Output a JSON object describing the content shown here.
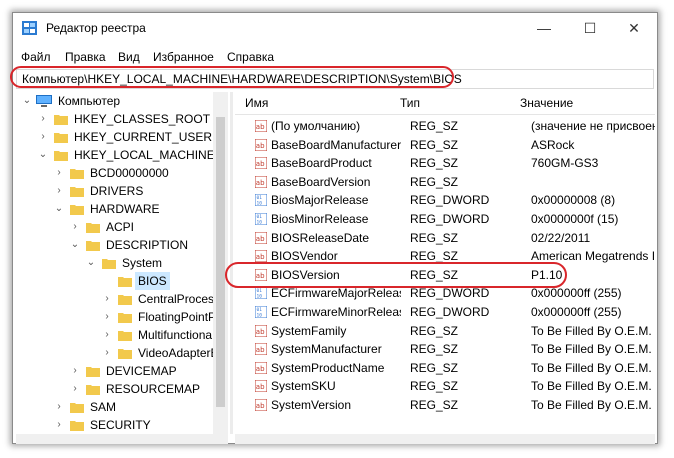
{
  "window": {
    "title": "Редактор реестра",
    "controls": {
      "minimize": "—",
      "maximize": "☐",
      "close": "✕"
    }
  },
  "menu": [
    "Файл",
    "Правка",
    "Вид",
    "Избранное",
    "Справка"
  ],
  "address": {
    "path": "Компьютер\\HKEY_LOCAL_MACHINE\\HARDWARE\\DESCRIPTION\\System\\BIOS"
  },
  "tree": {
    "items": [
      {
        "label": "Компьютер"
      },
      {
        "label": "HKEY_CLASSES_ROOT"
      },
      {
        "label": "HKEY_CURRENT_USER"
      },
      {
        "label": "HKEY_LOCAL_MACHINE"
      },
      {
        "label": "BCD00000000"
      },
      {
        "label": "DRIVERS"
      },
      {
        "label": "HARDWARE"
      },
      {
        "label": "ACPI"
      },
      {
        "label": "DESCRIPTION"
      },
      {
        "label": "System"
      },
      {
        "label": "BIOS"
      },
      {
        "label": "CentralProcess"
      },
      {
        "label": "FloatingPointP"
      },
      {
        "label": "Multifunctiona"
      },
      {
        "label": "VideoAdapterB"
      },
      {
        "label": "DEVICEMAP"
      },
      {
        "label": "RESOURCEMAP"
      },
      {
        "label": "SAM"
      },
      {
        "label": "SECURITY"
      }
    ]
  },
  "table": {
    "columns": {
      "name": "Имя",
      "type": "Тип",
      "value": "Значение"
    },
    "rows": [
      {
        "name": "(По умолчанию)",
        "type": "REG_SZ",
        "value": "(значение не присвоено)",
        "icon": "ab"
      },
      {
        "name": "BaseBoardManufacturer",
        "type": "REG_SZ",
        "value": "ASRock",
        "icon": "ab"
      },
      {
        "name": "BaseBoardProduct",
        "type": "REG_SZ",
        "value": "760GM-GS3",
        "icon": "ab"
      },
      {
        "name": "BaseBoardVersion",
        "type": "REG_SZ",
        "value": "",
        "icon": "ab"
      },
      {
        "name": "BiosMajorRelease",
        "type": "REG_DWORD",
        "value": "0x00000008 (8)",
        "icon": "bin"
      },
      {
        "name": "BiosMinorRelease",
        "type": "REG_DWORD",
        "value": "0x0000000f (15)",
        "icon": "bin"
      },
      {
        "name": "BIOSReleaseDate",
        "type": "REG_SZ",
        "value": "02/22/2011",
        "icon": "ab"
      },
      {
        "name": "BIOSVendor",
        "type": "REG_SZ",
        "value": "American Megatrends Inc.",
        "icon": "ab"
      },
      {
        "name": "BIOSVersion",
        "type": "REG_SZ",
        "value": "P1.10",
        "icon": "ab"
      },
      {
        "name": "ECFirmwareMajorReleas",
        "type": "REG_DWORD",
        "value": "0x000000ff (255)",
        "icon": "bin"
      },
      {
        "name": "ECFirmwareMinorReleas",
        "type": "REG_DWORD",
        "value": "0x000000ff (255)",
        "icon": "bin"
      },
      {
        "name": "SystemFamily",
        "type": "REG_SZ",
        "value": "To Be Filled By O.E.M.",
        "icon": "ab"
      },
      {
        "name": "SystemManufacturer",
        "type": "REG_SZ",
        "value": "To Be Filled By O.E.M.",
        "icon": "ab"
      },
      {
        "name": "SystemProductName",
        "type": "REG_SZ",
        "value": "To Be Filled By O.E.M.",
        "icon": "ab"
      },
      {
        "name": "SystemSKU",
        "type": "REG_SZ",
        "value": "To Be Filled By O.E.M.",
        "icon": "ab"
      },
      {
        "name": "SystemVersion",
        "type": "REG_SZ",
        "value": "To Be Filled By O.E.M.",
        "icon": "ab"
      }
    ]
  },
  "colors": {
    "highlight": "#d9262b",
    "selection": "#cce8ff",
    "folder": "#f2c94c"
  }
}
